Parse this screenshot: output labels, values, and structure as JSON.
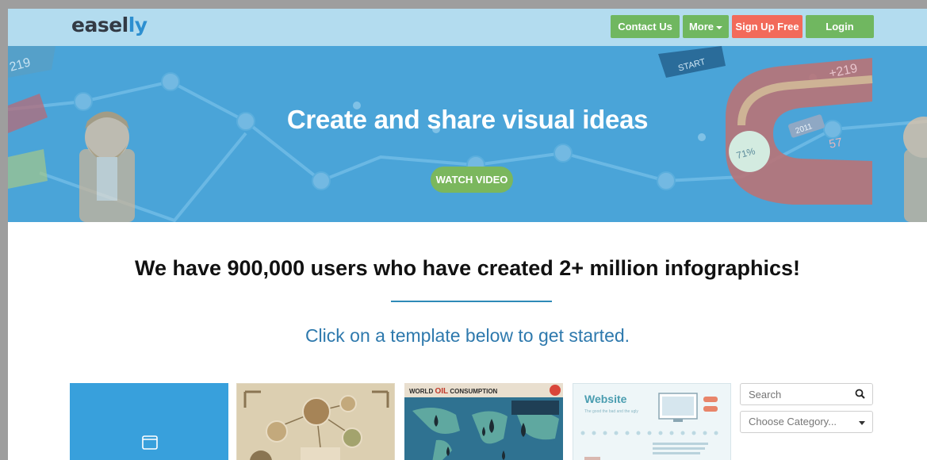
{
  "nav": {
    "logo_main": "easel",
    "logo_accent": "ly",
    "contact_label": "Contact Us",
    "more_label": "More",
    "signup_label": "Sign Up Free",
    "login_label": "Login"
  },
  "hero": {
    "title": "Create and share visual ideas",
    "watch_label": "WATCH VIDEO",
    "decor": {
      "start": "START",
      "plus_219": "+219",
      "left_219": "219",
      "year": "2011",
      "percent": "71%",
      "num_57": "57"
    }
  },
  "main": {
    "headline": "We have 900,000 users who have created 2+ million infographics!",
    "subline": "Click on a template below to get started."
  },
  "templates": {
    "oil_title_a": "WORLD ",
    "oil_title_b": "OIL",
    "oil_title_c": " CONSUMPTION",
    "website_title": "Website",
    "website_sub": "The good the bad and the ugly"
  },
  "search": {
    "placeholder": "Search",
    "category_placeholder": "Choose Category..."
  },
  "colors": {
    "navbar": "#b3dcef",
    "hero": "#4aa4d8",
    "green": "#70b760",
    "red": "#f26a5a",
    "accent_blue": "#2e79ad"
  }
}
